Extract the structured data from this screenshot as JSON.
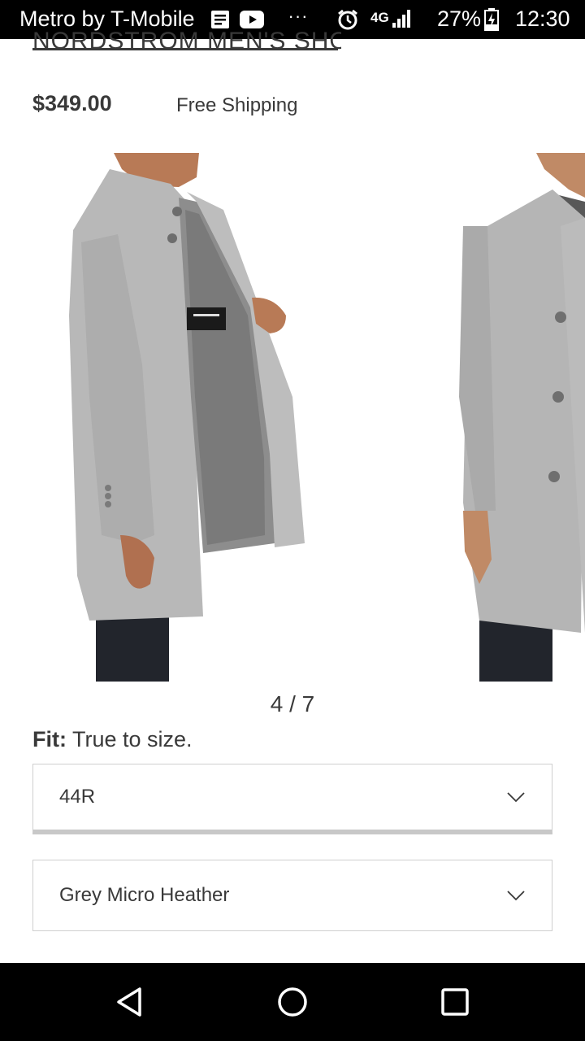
{
  "status_bar": {
    "carrier": "Metro by T-Mobile",
    "network": "4G",
    "battery": "27%",
    "time": "12:30",
    "icons": [
      "news-icon",
      "youtube-icon",
      "more-icon",
      "alarm-icon",
      "signal-icon",
      "battery-charging-icon"
    ]
  },
  "header": {
    "brand_link": "NORDSTROM MEN'S SHOP"
  },
  "product": {
    "price": "$349.00",
    "shipping": "Free Shipping"
  },
  "carousel": {
    "pager": "4 / 7",
    "current": 4,
    "total": 7
  },
  "fit": {
    "label": "Fit:",
    "value": "True to size."
  },
  "size_select": {
    "value": "44R"
  },
  "color_select": {
    "value": "Grey Micro Heather"
  },
  "colors": {
    "text": "#393939",
    "coat": "#b9b9b9",
    "border": "#cfcfcf"
  }
}
